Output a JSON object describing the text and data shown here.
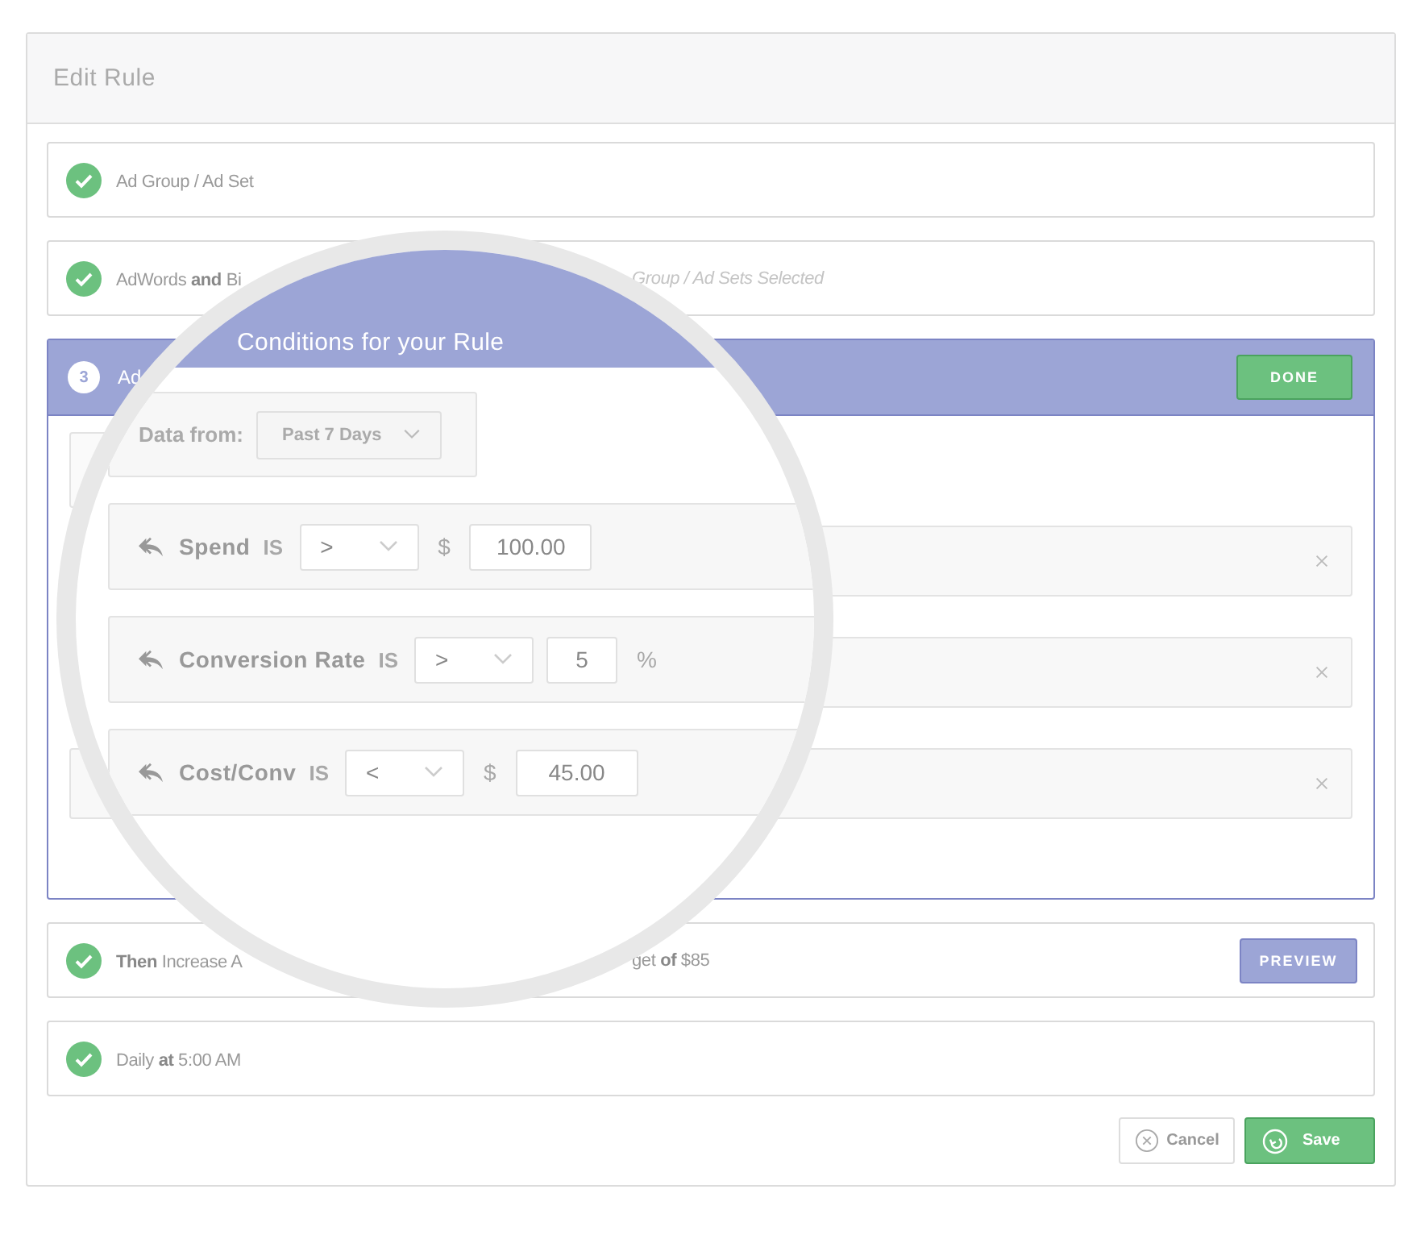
{
  "window": {
    "title": "Edit Rule"
  },
  "steps": [
    {
      "kind": "complete",
      "text": "Ad Group / Ad Set"
    },
    {
      "kind": "complete",
      "text": "AdWords **and** Bi",
      "text_after": "Group / Ad Sets Selected"
    },
    {
      "kind": "active",
      "number": "3",
      "text": "Ad",
      "button": "DONE"
    },
    {
      "kind": "complete",
      "text": "**Then** Increase A",
      "text_after": "get **of** $85",
      "button": "PREVIEW"
    },
    {
      "kind": "complete",
      "text": "Daily **at** 5:00 AM"
    }
  ],
  "magnifier": {
    "title": "Conditions for your Rule",
    "data_from": {
      "label": "Data from:",
      "value": "Past 7 Days"
    },
    "conditions": [
      {
        "kind": "currency",
        "metric": "Spend",
        "is": "IS",
        "operator": ">",
        "unit": "$",
        "value": "100.00"
      },
      {
        "kind": "percent",
        "metric": "Conversion Rate",
        "is": "IS",
        "operator": ">",
        "unit": "%",
        "value": "5"
      },
      {
        "kind": "currency",
        "metric": "Cost/Conv",
        "is": "IS",
        "operator": "<",
        "unit": "$",
        "value": "45.00"
      }
    ]
  },
  "footer": {
    "cancel": "Cancel",
    "save": "Save"
  }
}
